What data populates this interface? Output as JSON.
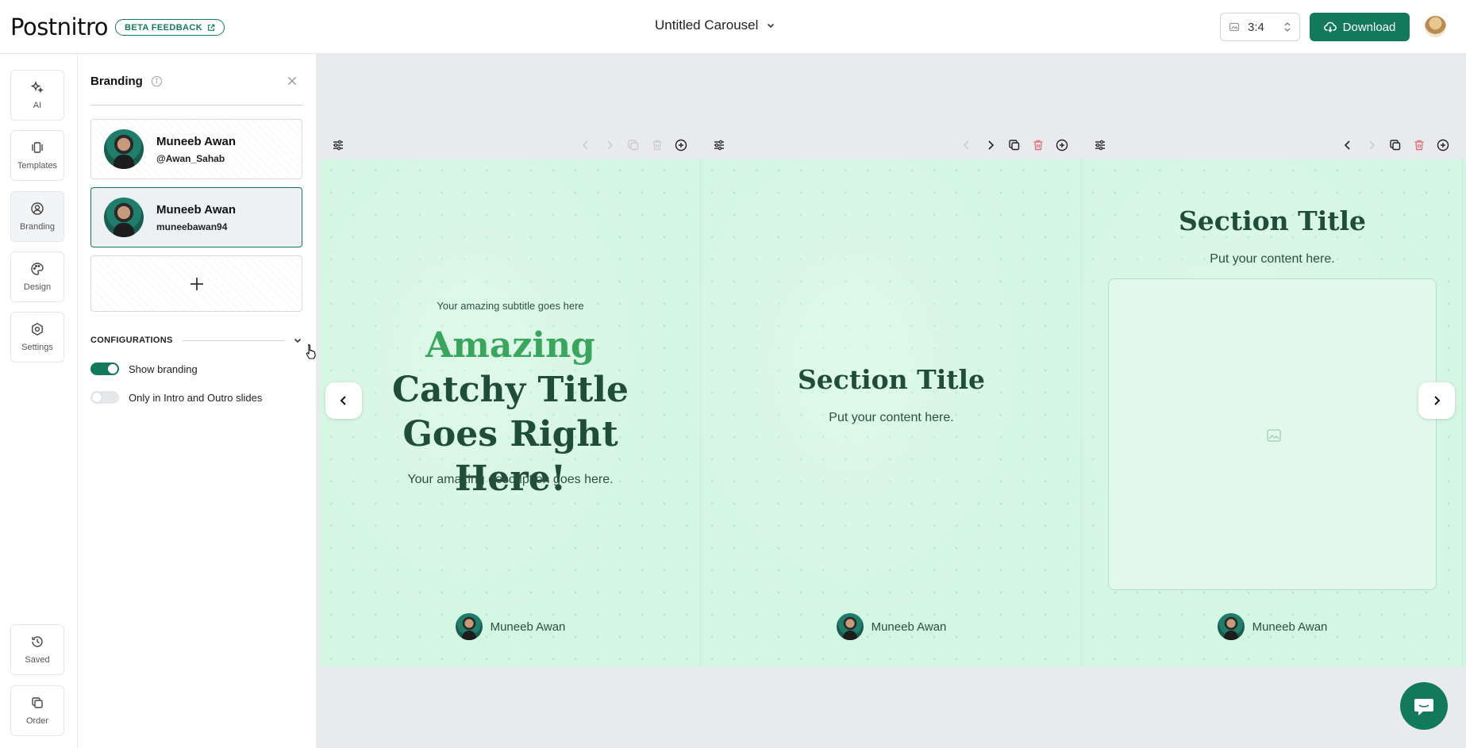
{
  "header": {
    "logo": "Postnitro",
    "beta_label": "BETA FEEDBACK",
    "carousel_title": "Untitled Carousel",
    "ratio_value": "3:4",
    "download_label": "Download"
  },
  "rail": {
    "top_items": [
      {
        "label": "AI",
        "icon": "sparkles-icon"
      },
      {
        "label": "Templates",
        "icon": "templates-icon"
      },
      {
        "label": "Branding",
        "icon": "user-circle-icon"
      },
      {
        "label": "Design",
        "icon": "palette-icon"
      },
      {
        "label": "Settings",
        "icon": "settings-icon"
      }
    ],
    "bottom_items": [
      {
        "label": "Saved",
        "icon": "history-icon"
      },
      {
        "label": "Order",
        "icon": "copy-icon"
      }
    ]
  },
  "panel": {
    "title": "Branding",
    "brands": [
      {
        "name": "Muneeb Awan",
        "handle": "@Awan_Sahab"
      },
      {
        "name": "Muneeb Awan",
        "handle": "muneebawan94"
      }
    ],
    "configurations_label": "CONFIGURATIONS",
    "toggles": [
      {
        "label": "Show branding",
        "on": true
      },
      {
        "label": "Only in Intro and Outro slides",
        "on": false
      }
    ]
  },
  "slides": {
    "intro": {
      "subtitle": "Your amazing subtitle goes here",
      "title_accent": "Amazing",
      "title_rest": "Catchy Title Goes Right Here!",
      "description": "Your amazing description goes here.",
      "author": "Muneeb Awan"
    },
    "section": {
      "title": "Section Title",
      "body": "Put your content here.",
      "author": "Muneeb Awan"
    },
    "section_image": {
      "title": "Section Title",
      "body": "Put your content here.",
      "author": "Muneeb Awan"
    }
  },
  "colors": {
    "brand": "#13795b",
    "slide_bg": "#d5f6e3",
    "title": "#1f4d3a",
    "accent": "#3aa55d",
    "delete": "#e57373"
  }
}
